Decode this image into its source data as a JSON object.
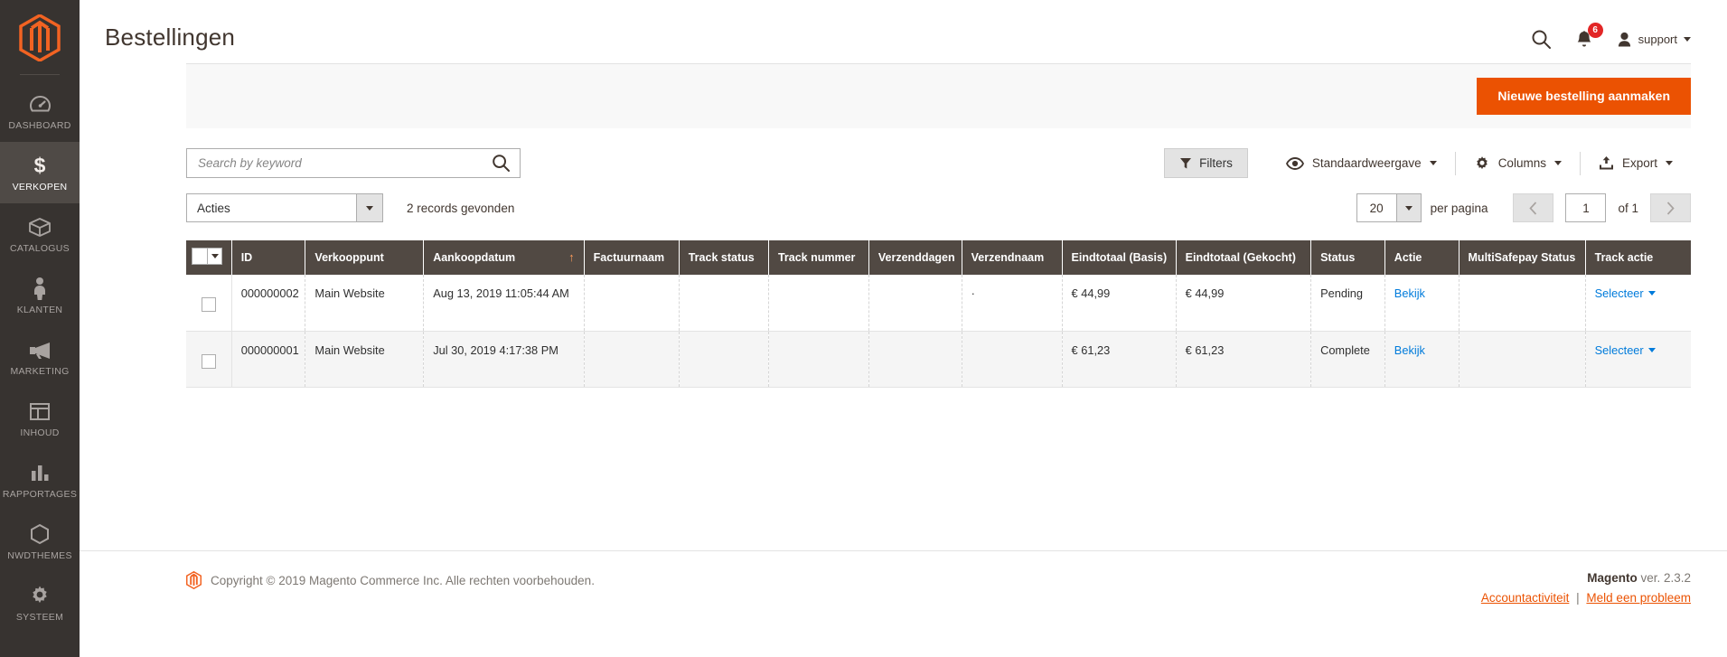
{
  "sidebar": {
    "logo": "magento-logo",
    "items": [
      {
        "label": "DASHBOARD",
        "icon": "dashboard-gauge-icon",
        "active": false
      },
      {
        "label": "VERKOPEN",
        "icon": "dollar-sign-icon",
        "active": true
      },
      {
        "label": "CATALOGUS",
        "icon": "box-icon",
        "active": false
      },
      {
        "label": "KLANTEN",
        "icon": "person-icon",
        "active": false
      },
      {
        "label": "MARKETING",
        "icon": "megaphone-icon",
        "active": false
      },
      {
        "label": "INHOUD",
        "icon": "layout-window-icon",
        "active": false
      },
      {
        "label": "RAPPORTAGES",
        "icon": "bar-chart-icon",
        "active": false
      },
      {
        "label": "NWDTHEMES",
        "icon": "hexagon-icon",
        "active": false
      },
      {
        "label": "SYSTEEM",
        "icon": "gear-icon",
        "active": false
      }
    ]
  },
  "header": {
    "title": "Bestellingen",
    "search_icon": "search-icon",
    "notifications_icon": "bell-icon",
    "notifications_count": "6",
    "user_icon": "user-avatar-icon",
    "user_name": "support"
  },
  "actions_bar": {
    "new_order_label": "Nieuwe bestelling aanmaken"
  },
  "toolbar": {
    "search_placeholder": "Search by keyword",
    "search_value": "",
    "search_icon": "search-icon",
    "filters_label": "Filters",
    "filters_icon": "funnel-icon",
    "view_label": "Standaardweergave",
    "view_icon": "eye-icon",
    "columns_label": "Columns",
    "columns_icon": "gear-icon",
    "export_label": "Export",
    "export_icon": "export-upload-icon"
  },
  "controls": {
    "actions_label": "Acties",
    "records_found": "2 records gevonden",
    "per_page_value": "20",
    "per_page_label": "per pagina",
    "prev_icon": "chevron-left-icon",
    "next_icon": "chevron-right-icon",
    "page_value": "1",
    "page_of": "of 1"
  },
  "grid": {
    "columns": [
      {
        "label": "",
        "name": "select-all"
      },
      {
        "label": "ID",
        "name": "id"
      },
      {
        "label": "Verkooppunt",
        "name": "verkooppunt"
      },
      {
        "label": "Aankoopdatum",
        "name": "aankoopdatum",
        "sort": "asc"
      },
      {
        "label": "Factuurnaam",
        "name": "factuurnaam"
      },
      {
        "label": "Track status",
        "name": "track-status"
      },
      {
        "label": "Track nummer",
        "name": "track-nummer"
      },
      {
        "label": "Verzenddagen",
        "name": "verzenddagen"
      },
      {
        "label": "Verzendnaam",
        "name": "verzendnaam"
      },
      {
        "label": "Eindtotaal (Basis)",
        "name": "eindtotaal-basis"
      },
      {
        "label": "Eindtotaal (Gekocht)",
        "name": "eindtotaal-gekocht"
      },
      {
        "label": "Status",
        "name": "status"
      },
      {
        "label": "Actie",
        "name": "actie"
      },
      {
        "label": "MultiSafepay Status",
        "name": "multisafepay-status"
      },
      {
        "label": "Track actie",
        "name": "track-actie"
      }
    ],
    "sort_arrow": "↑",
    "rows": [
      {
        "id": "000000002",
        "verkooppunt": "Main Website",
        "aankoopdatum": "Aug 13, 2019 11:05:44 AM",
        "factuurnaam": "",
        "track_status": "",
        "track_nummer": "",
        "verzenddagen": "",
        "verzendnaam": "·",
        "eindtotaal_basis": "€ 44,99",
        "eindtotaal_gekocht": "€ 44,99",
        "status": "Pending",
        "actie": "Bekijk",
        "multisafepay_status": "",
        "track_actie": "Selecteer"
      },
      {
        "id": "000000001",
        "verkooppunt": "Main Website",
        "aankoopdatum": "Jul 30, 2019 4:17:38 PM",
        "factuurnaam": "",
        "track_status": "",
        "track_nummer": "",
        "verzenddagen": "",
        "verzendnaam": "",
        "eindtotaal_basis": "€ 61,23",
        "eindtotaal_gekocht": "€ 61,23",
        "status": "Complete",
        "actie": "Bekijk",
        "multisafepay_status": "",
        "track_actie": "Selecteer"
      }
    ]
  },
  "footer": {
    "copyright": "Copyright © 2019 Magento Commerce Inc. Alle rechten voorbehouden.",
    "brand": "Magento",
    "version": " ver. 2.3.2",
    "link_activity": "Accountactiviteit",
    "link_report": "Meld een probleem",
    "link_separator": "|"
  },
  "colors": {
    "brand_orange": "#eb5202",
    "sidebar_bg": "#373330",
    "table_header": "#514943",
    "link_blue": "#007bdb",
    "badge_red": "#e22626"
  }
}
